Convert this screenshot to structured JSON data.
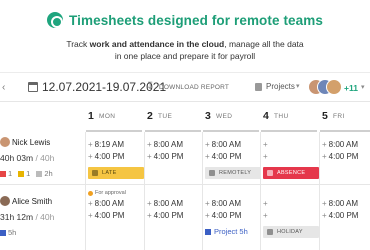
{
  "hero": {
    "title": "Timesheets designed for remote teams",
    "sub_pre": "Track ",
    "sub_bold": "work and attendance in the cloud",
    "sub_post": ", manage all the data",
    "sub_line2": "in one place and prepare it for payroll"
  },
  "toolbar": {
    "date_range": "12.07.2021-19.07.2021",
    "download_label": "DOWNLOAD REPORT",
    "projects_label": "Projects",
    "more_count": "+11"
  },
  "days": [
    {
      "num": "1",
      "wd": "MON"
    },
    {
      "num": "2",
      "wd": "TUE"
    },
    {
      "num": "3",
      "wd": "WED"
    },
    {
      "num": "4",
      "wd": "THU"
    },
    {
      "num": "5",
      "wd": "FRI"
    }
  ],
  "people": [
    {
      "name": "Nick Lewis",
      "hours": "40h 03m",
      "total": " / 40h",
      "stats": [
        "1",
        "1",
        "2h"
      ],
      "cells": [
        {
          "lines": [
            "8:19 AM",
            "4:00 PM"
          ],
          "tag": "LATE"
        },
        {
          "lines": [
            "8:00 AM",
            "4:00 PM"
          ]
        },
        {
          "lines": [
            "8:00 AM",
            "4:00 PM"
          ],
          "tag": "REMOTELY"
        },
        {
          "lines": [
            "",
            ""
          ],
          "tag": "ABSENCE"
        },
        {
          "lines": [
            "8:00 AM",
            "4:00 PM"
          ]
        }
      ]
    },
    {
      "name": "Alice Smith",
      "hours": "31h 12m",
      "total": " / 40h",
      "stats": [
        "5h"
      ],
      "cells": [
        {
          "approval": "For approval",
          "lines": [
            "8:00 AM",
            "4:00 PM"
          ]
        },
        {
          "lines": [
            "8:00 AM",
            "4:00 PM"
          ]
        },
        {
          "lines": [
            "8:00 AM",
            "4:00 PM"
          ],
          "project": "Project 5h"
        },
        {
          "lines": [
            "",
            ""
          ],
          "tag": "HOLIDAY"
        },
        {
          "lines": [
            "8:00 AM",
            "4:00 PM"
          ]
        }
      ]
    }
  ],
  "colors": {
    "brand": "#1d9e77",
    "late": "#f5c542",
    "absence": "#e5374b",
    "project": "#3b5fc4"
  }
}
